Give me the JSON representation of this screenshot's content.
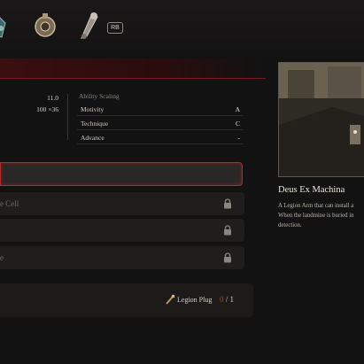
{
  "key_hint": "RB",
  "stats": [
    {
      "value": "11.0"
    },
    {
      "value": "100 ×36"
    }
  ],
  "ability_scaling": {
    "title": "Ability Scaling",
    "rows": [
      {
        "label": "Motivity",
        "grade": "A"
      },
      {
        "label": "Technique",
        "grade": "C"
      },
      {
        "label": "Advance",
        "grade": "-"
      }
    ]
  },
  "slots": [
    {
      "text": "",
      "locked": false,
      "selected": true
    },
    {
      "text": "e Cell",
      "locked": true,
      "selected": false
    },
    {
      "text": "",
      "locked": true,
      "selected": false
    },
    {
      "text": "e",
      "locked": true,
      "selected": false
    }
  ],
  "legion_plug": {
    "label": "Legion Plug",
    "current": "0",
    "separator": "/",
    "total": "1"
  },
  "detail": {
    "name": "Deus Ex Machina",
    "desc_lines": [
      "A Legion Arm that can install a",
      "When the landmine is buried in",
      "detection."
    ]
  },
  "colors": {
    "accent_red": "#b02a2a",
    "plug_current": "#c0392b"
  }
}
